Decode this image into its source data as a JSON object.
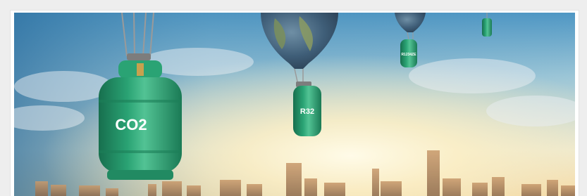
{
  "banner": {
    "labels": {
      "co2": "CO2",
      "r32": "R32",
      "r1234": "R1234ZE"
    },
    "colors": {
      "sky_top": "#5aa2c8",
      "sky_mid": "#cfe1e6",
      "sun_glow": "#fff6d6",
      "horizon": "#f4d9a2",
      "cylinder_green": "#2aa374",
      "cylinder_dark": "#1d7f59",
      "cylinder_light": "#52c394",
      "skyline": "#b78a62"
    }
  }
}
